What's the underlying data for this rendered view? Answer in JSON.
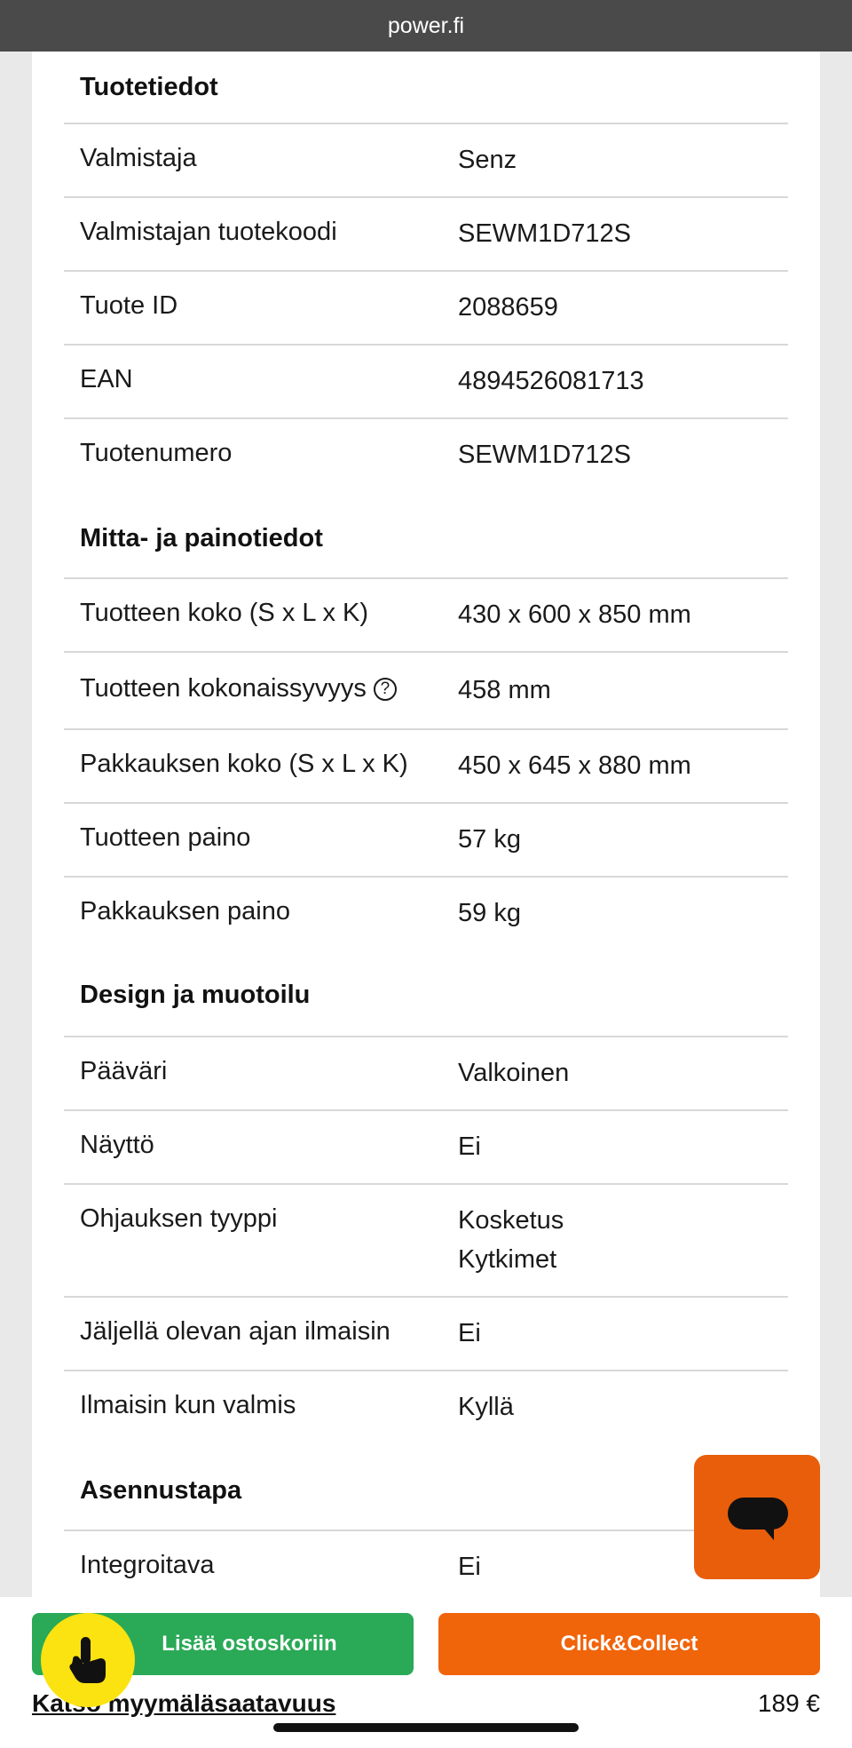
{
  "browser": {
    "url": "power.fi"
  },
  "sections": [
    {
      "title": "Tuotetiedot",
      "rows": [
        {
          "label": "Valmistaja",
          "value": "Senz"
        },
        {
          "label": "Valmistajan tuotekoodi",
          "value": "SEWM1D712S"
        },
        {
          "label": "Tuote ID",
          "value": "2088659"
        },
        {
          "label": "EAN",
          "value": "4894526081713"
        },
        {
          "label": "Tuotenumero",
          "value": "SEWM1D712S"
        }
      ]
    },
    {
      "title": "Mitta- ja painotiedot",
      "rows": [
        {
          "label": "Tuotteen koko (S x L x K)",
          "value": "430 x 600 x 850 mm"
        },
        {
          "label": "Tuotteen kokonaissyvyys",
          "value": "458 mm",
          "help_icon": "?"
        },
        {
          "label": "Pakkauksen koko (S x L x K)",
          "value": "450 x 645 x 880 mm"
        },
        {
          "label": "Tuotteen paino",
          "value": "57 kg"
        },
        {
          "label": "Pakkauksen paino",
          "value": "59 kg"
        }
      ]
    },
    {
      "title": "Design ja muotoilu",
      "rows": [
        {
          "label": "Pääväri",
          "value": "Valkoinen"
        },
        {
          "label": "Näyttö",
          "value": "Ei"
        },
        {
          "label": "Ohjauksen tyyppi",
          "value": "Kosketus",
          "value2": "Kytkimet"
        },
        {
          "label": "Jäljellä olevan ajan ilmaisin",
          "value": "Ei"
        },
        {
          "label": "Ilmaisin kun valmis",
          "value": "Kyllä"
        }
      ]
    },
    {
      "title": "Asennustapa",
      "rows": [
        {
          "label": "Integroitava",
          "value": "Ei"
        }
      ]
    }
  ],
  "actions": {
    "add_to_cart": "Lisää ostoskoriin",
    "click_collect": "Click&Collect",
    "store_availability": "Katso myymäläsaatavuus",
    "price": "189 €"
  },
  "icons": {
    "chat": "chat-bubble-icon",
    "tap": "hand-pointer-icon",
    "help": "question-circle-icon"
  },
  "colors": {
    "green_button": "#2aa956",
    "orange_button": "#f0640a",
    "chat_button": "#e85e0a",
    "tap_badge": "#fbe311",
    "top_bar": "#4a4a4a"
  }
}
